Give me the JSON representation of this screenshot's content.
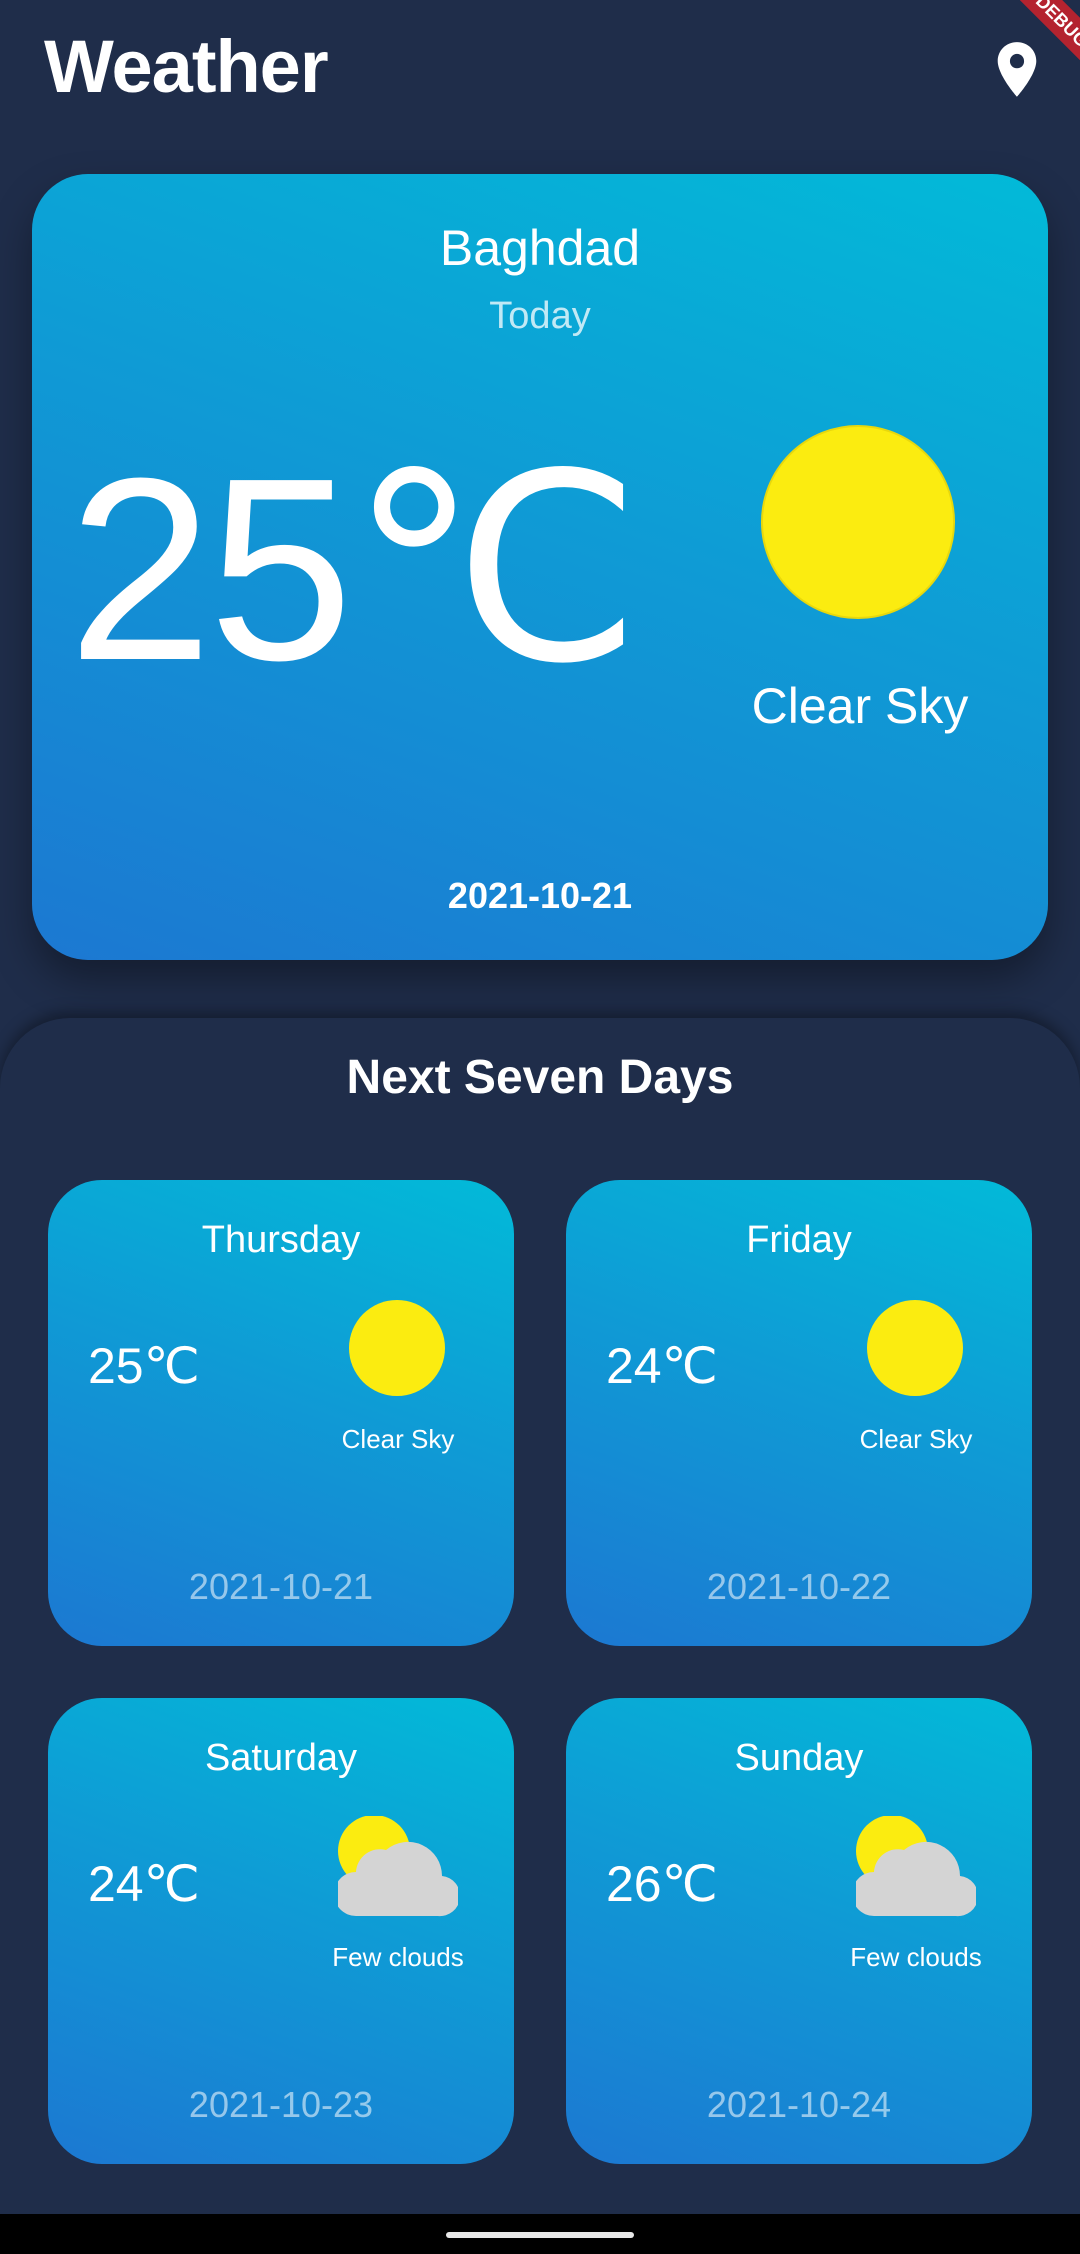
{
  "app": {
    "title": "Weather",
    "location_icon": "location-pin-icon",
    "debug_banner": "DEBUG"
  },
  "colors": {
    "background": "#1f2d4a",
    "card_gradient_start": "#1c78d2",
    "card_gradient_end": "#02bad8",
    "sun": "#fbec10",
    "cloud": "#d4d4d4"
  },
  "today": {
    "city": "Baghdad",
    "label": "Today",
    "temperature": "25℃",
    "condition": "Clear Sky",
    "icon": "sun-icon",
    "date": "2021-10-21"
  },
  "forecast": {
    "title": "Next Seven Days",
    "days": [
      {
        "name": "Thursday",
        "temperature": "25℃",
        "condition": "Clear Sky",
        "icon": "sun-icon",
        "date": "2021-10-21"
      },
      {
        "name": "Friday",
        "temperature": "24℃",
        "condition": "Clear Sky",
        "icon": "sun-icon",
        "date": "2021-10-22"
      },
      {
        "name": "Saturday",
        "temperature": "24℃",
        "condition": "Few clouds",
        "icon": "few-clouds-icon",
        "date": "2021-10-23"
      },
      {
        "name": "Sunday",
        "temperature": "26℃",
        "condition": "Few clouds",
        "icon": "few-clouds-icon",
        "date": "2021-10-24"
      }
    ]
  }
}
